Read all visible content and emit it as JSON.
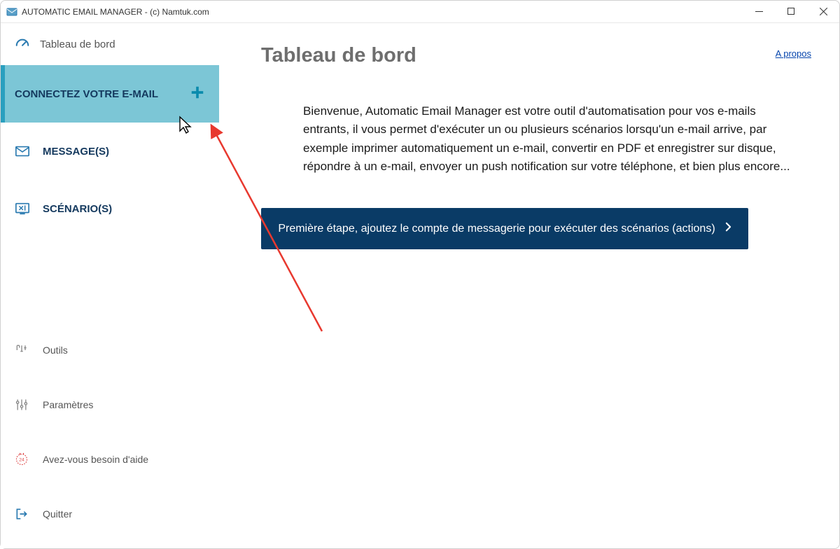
{
  "window": {
    "title": "AUTOMATIC EMAIL MANAGER - (c) Namtuk.com"
  },
  "sidebar": {
    "header_label": "Tableau de bord",
    "primary": [
      {
        "label": "CONNECTEZ VOTRE E-MAIL",
        "has_plus": true,
        "active": true
      },
      {
        "label": "MESSAGE(S)"
      },
      {
        "label": "SCÉNARIO(S)"
      }
    ],
    "secondary": [
      {
        "label": "Outils"
      },
      {
        "label": "Paramètres"
      },
      {
        "label": "Avez-vous besoin d'aide"
      },
      {
        "label": "Quitter"
      }
    ]
  },
  "content": {
    "page_title": "Tableau de bord",
    "about_link": "A propos",
    "welcome_text": "Bienvenue, Automatic Email Manager est votre outil d'automatisation pour vos e-mails entrants, il vous permet d'exécuter un ou plusieurs scénarios lorsqu'un e-mail arrive, par exemple imprimer automatiquement un e-mail, convertir en PDF et enregistrer sur disque, répondre à un e-mail, envoyer un push notification sur votre téléphone, et bien plus encore...",
    "cta_label": "Première étape, ajoutez le compte de messagerie pour exécuter des scénarios (actions)"
  }
}
